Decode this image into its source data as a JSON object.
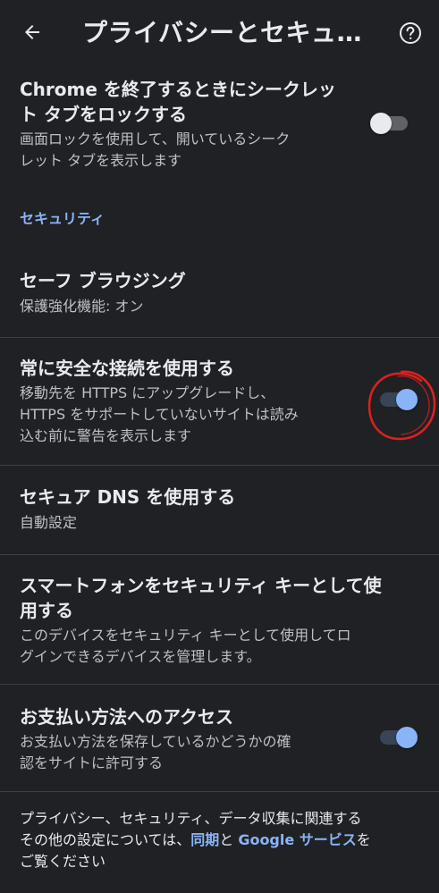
{
  "header": {
    "title": "プライバシーとセキュ…",
    "back_icon": "arrow-back-icon",
    "help_icon": "help-circle-icon"
  },
  "settings": {
    "lock_incognito": {
      "title_line1": "Chrome を終了するときにシークレッ",
      "title_line2": "ト タブをロックする",
      "sub_line1": "画面ロックを使用して、開いているシーク",
      "sub_line2": "レット タブを表示します",
      "enabled": false
    },
    "section_security": "セキュリティ",
    "safe_browsing": {
      "title": "セーフ ブラウジング",
      "sub": "保護強化機能: オン"
    },
    "https_first": {
      "title": "常に安全な接続を使用する",
      "sub_line1": "移動先を HTTPS にアップグレードし、",
      "sub_line2": "HTTPS をサポートしていないサイトは読み",
      "sub_line3": "込む前に警告を表示します",
      "enabled": true
    },
    "secure_dns": {
      "title": "セキュア DNS を使用する",
      "sub": "自動設定"
    },
    "security_key": {
      "title_line1": "スマートフォンをセキュリティ キーとして使",
      "title_line2": "用する",
      "sub_line1": "このデバイスをセキュリティ キーとして使用してロ",
      "sub_line2": "グインできるデバイスを管理します。"
    },
    "payment_methods": {
      "title": "お支払い方法へのアクセス",
      "sub_line1": "お支払い方法を保存しているかどうかの確",
      "sub_line2": "認をサイトに許可する",
      "enabled": true
    }
  },
  "footer": {
    "line1": "プライバシー、セキュリティ、データ収集に関連する",
    "line2_prefix": "その他の設定については、",
    "link_sync": "同期",
    "line2_mid": "と ",
    "link_google_services": "Google サービス",
    "line2_suffix": "を",
    "line3": "ご覧ください"
  },
  "colors": {
    "background": "#1f2124",
    "accent": "#8ab4f8",
    "annotation": "#e0201b"
  }
}
